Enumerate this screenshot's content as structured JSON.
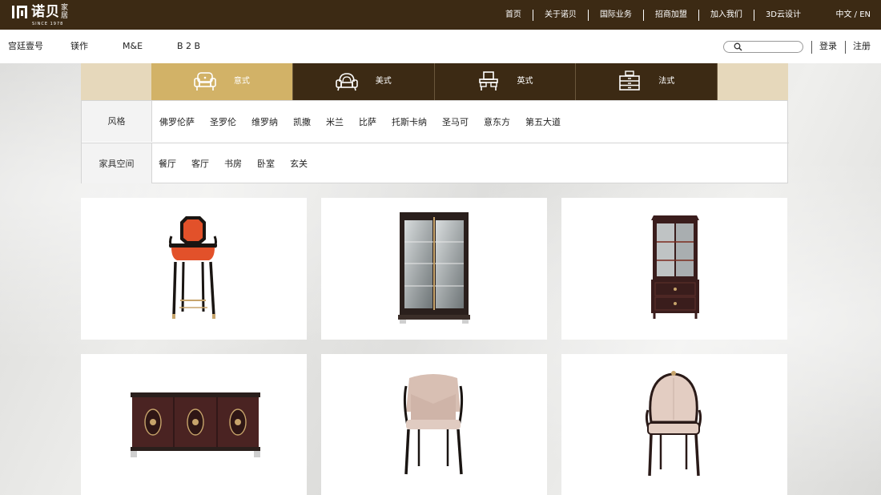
{
  "brand": {
    "name": "诺贝",
    "suffix_top": "家",
    "suffix_bottom": "居",
    "since": "SINCE 1978"
  },
  "topnav": [
    "首页",
    "关于诺贝",
    "国际业务",
    "招商加盟",
    "加入我们",
    "3D云设计"
  ],
  "language": "中文 / EN",
  "subnav": [
    "宫廷壹号",
    "镁作",
    "M&E",
    "B 2 B"
  ],
  "search": {
    "placeholder": ""
  },
  "auth": {
    "login": "登录",
    "register": "注册"
  },
  "categories": [
    {
      "label": "意式",
      "icon": "sofa-icon",
      "active": true
    },
    {
      "label": "美式",
      "icon": "armchair-icon",
      "active": false
    },
    {
      "label": "英式",
      "icon": "vanity-icon",
      "active": false
    },
    {
      "label": "法式",
      "icon": "dresser-icon",
      "active": false
    }
  ],
  "filters": {
    "style": {
      "label": "风格",
      "options": [
        "佛罗伦萨",
        "圣罗伦",
        "维罗纳",
        "凯撒",
        "米兰",
        "比萨",
        "托斯卡纳",
        "圣马可",
        "意东方",
        "第五大道"
      ]
    },
    "space": {
      "label": "家具空间",
      "options": [
        "餐厅",
        "客厅",
        "书房",
        "卧室",
        "玄关"
      ]
    }
  },
  "products": [
    {
      "type": "bar-stool"
    },
    {
      "type": "glass-cabinet"
    },
    {
      "type": "display-cabinet"
    },
    {
      "type": "sideboard"
    },
    {
      "type": "dining-chair"
    },
    {
      "type": "wingback-chair"
    }
  ],
  "colors": {
    "brand_brown": "#3c2a14",
    "accent_gold": "#d2b267"
  }
}
